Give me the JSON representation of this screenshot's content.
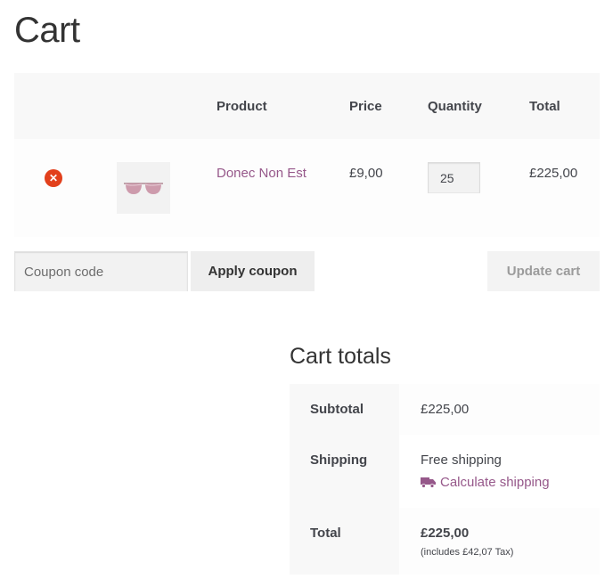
{
  "page": {
    "title": "Cart"
  },
  "cart_table": {
    "headers": {
      "product": "Product",
      "price": "Price",
      "quantity": "Quantity",
      "total": "Total"
    },
    "items": [
      {
        "name": "Donec Non Est",
        "price": "£9,00",
        "quantity": "25",
        "total": "£225,00",
        "thumbnail_icon": "sunglasses-icon"
      }
    ],
    "remove_glyph": "✕"
  },
  "actions": {
    "coupon_placeholder": "Coupon code",
    "apply_coupon_label": "Apply coupon",
    "update_cart_label": "Update cart"
  },
  "cart_totals": {
    "title": "Cart totals",
    "subtotal_label": "Subtotal",
    "subtotal_value": "£225,00",
    "shipping_label": "Shipping",
    "shipping_value": "Free shipping",
    "calculate_shipping": "Calculate shipping",
    "total_label": "Total",
    "total_value": "£225,00",
    "tax_note": "(includes £42,07 Tax)"
  },
  "colors": {
    "link": "#96588a",
    "remove": "#e2401c",
    "header_bg": "#f8f8f8"
  }
}
